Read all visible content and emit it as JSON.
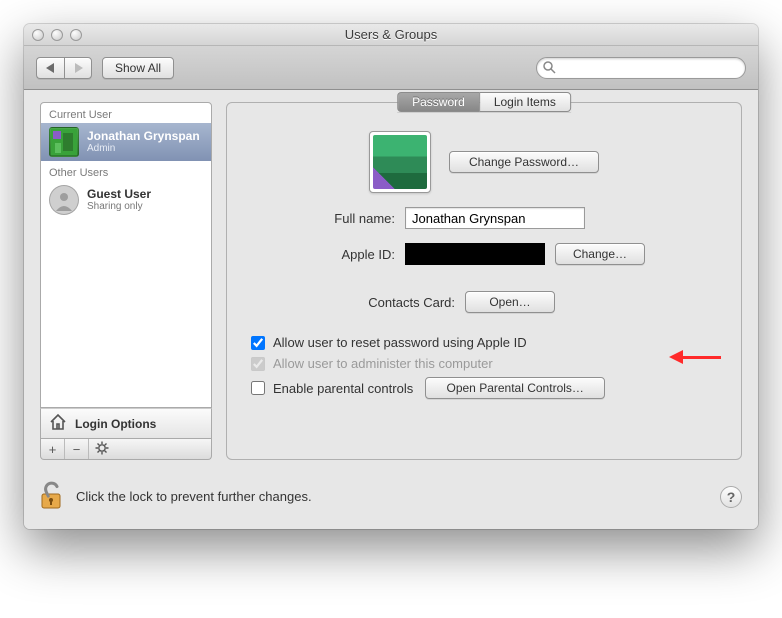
{
  "window": {
    "title": "Users & Groups"
  },
  "toolbar": {
    "show_all": "Show All",
    "search_placeholder": ""
  },
  "sidebar": {
    "headers": {
      "current": "Current User",
      "other": "Other Users"
    },
    "login_options": "Login Options",
    "users": [
      {
        "name": "Jonathan Grynspan",
        "role": "Admin",
        "selected": true
      },
      {
        "name": "Guest User",
        "role": "Sharing only",
        "selected": false
      }
    ]
  },
  "tabs": {
    "password": "Password",
    "login_items": "Login Items",
    "active": "password"
  },
  "buttons": {
    "change_password": "Change Password…",
    "change": "Change…",
    "open": "Open…",
    "open_parental": "Open Parental Controls…"
  },
  "labels": {
    "full_name": "Full name:",
    "apple_id": "Apple ID:",
    "contacts_card": "Contacts Card:"
  },
  "values": {
    "full_name": "Jonathan Grynspan",
    "apple_id": ""
  },
  "checks": {
    "allow_reset": {
      "label": "Allow user to reset password using Apple ID",
      "checked": true,
      "enabled": true
    },
    "allow_admin": {
      "label": "Allow user to administer this computer",
      "checked": true,
      "enabled": false
    },
    "parental": {
      "label": "Enable parental controls",
      "checked": false,
      "enabled": true
    }
  },
  "footer": {
    "lock_text": "Click the lock to prevent further changes."
  }
}
